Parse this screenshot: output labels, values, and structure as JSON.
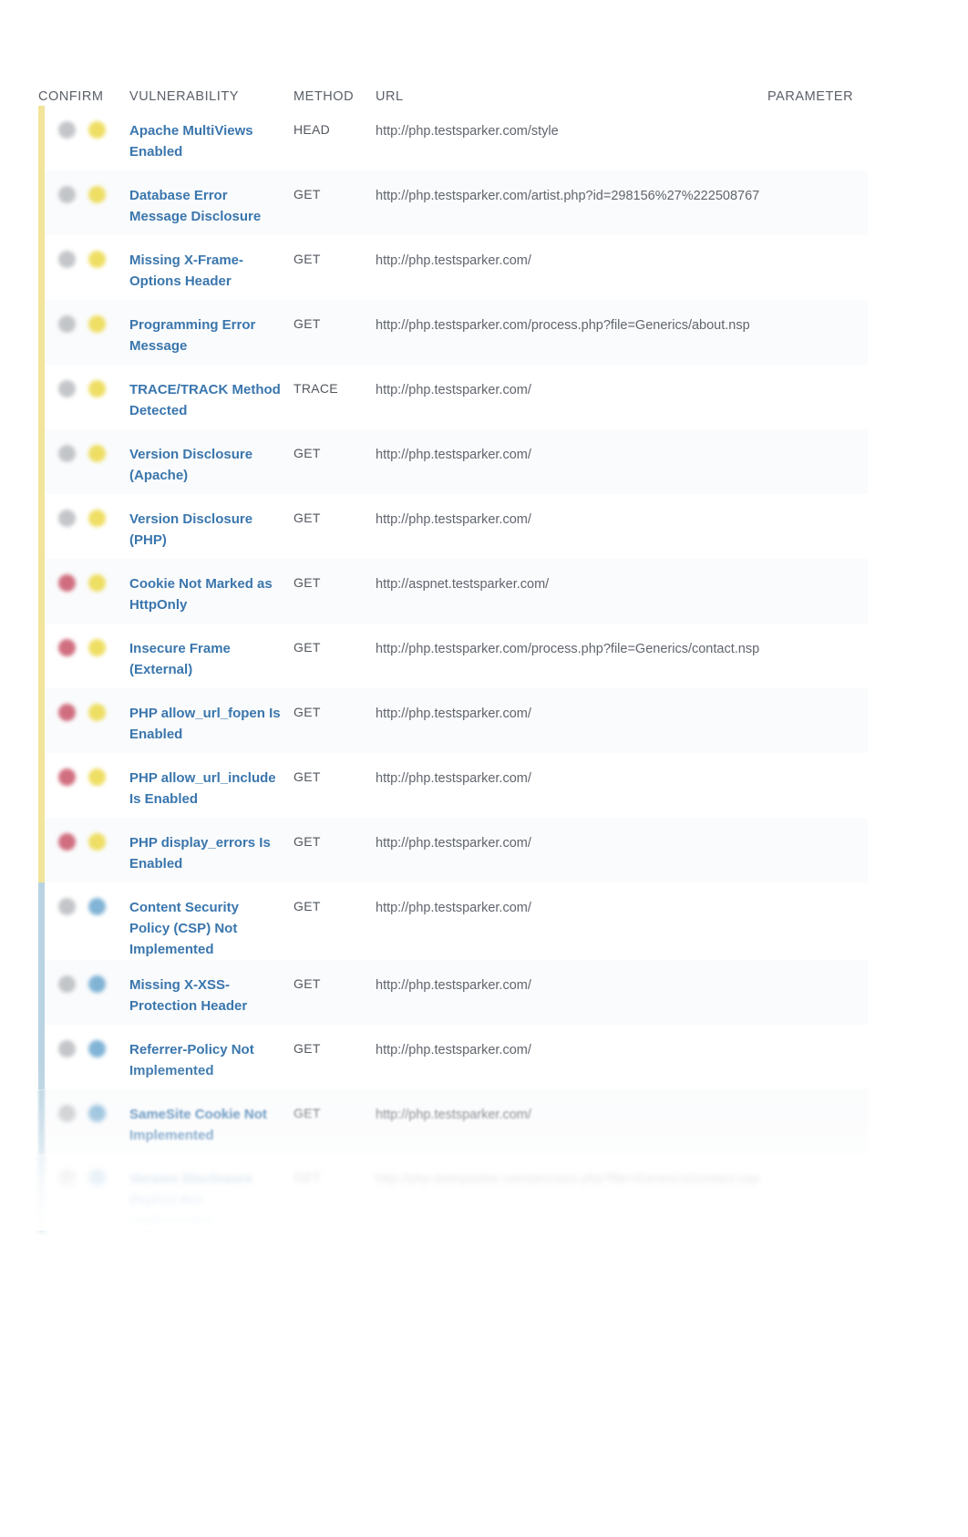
{
  "table": {
    "columns": [
      {
        "key": "confirm",
        "label": "CONFIRM"
      },
      {
        "key": "vulnerability",
        "label": "VULNERABILITY"
      },
      {
        "key": "method",
        "label": "METHOD"
      },
      {
        "key": "url",
        "label": "URL"
      },
      {
        "key": "parameter",
        "label": "PARAMETER"
      }
    ],
    "colors": {
      "severity_low": "#ecd949",
      "severity_information": "#6ca7cf",
      "confirmed_marker": "#c9566a",
      "unconfirmed_marker": "#b9bcc0",
      "link": "#3a76ad",
      "stripe_low": "#f2e49a",
      "stripe_information": "#b9d3e2"
    },
    "rows": [
      {
        "confirm_icon": "unconfirmed-marker-icon",
        "severity_icon": "severity-low-icon",
        "severity": "low",
        "vulnerability": "Apache MultiViews Enabled",
        "method": "HEAD",
        "url": "http://php.testsparker.com/style",
        "parameter": ""
      },
      {
        "confirm_icon": "unconfirmed-marker-icon",
        "severity_icon": "severity-low-icon",
        "severity": "low",
        "vulnerability": "Database Error Message Disclosure",
        "method": "GET",
        "url": "http://php.testsparker.com/artist.php?id=298156%27%222508767",
        "parameter": ""
      },
      {
        "confirm_icon": "unconfirmed-marker-icon",
        "severity_icon": "severity-low-icon",
        "severity": "low",
        "vulnerability": "Missing X-Frame-Options Header",
        "method": "GET",
        "url": "http://php.testsparker.com/",
        "parameter": ""
      },
      {
        "confirm_icon": "unconfirmed-marker-icon",
        "severity_icon": "severity-low-icon",
        "severity": "low",
        "vulnerability": "Programming Error Message",
        "method": "GET",
        "url": "http://php.testsparker.com/process.php?file=Generics/about.nsp",
        "parameter": ""
      },
      {
        "confirm_icon": "unconfirmed-marker-icon",
        "severity_icon": "severity-low-icon",
        "severity": "low",
        "vulnerability": "TRACE/TRACK Method Detected",
        "method": "TRACE",
        "url": "http://php.testsparker.com/",
        "parameter": ""
      },
      {
        "confirm_icon": "unconfirmed-marker-icon",
        "severity_icon": "severity-low-icon",
        "severity": "low",
        "vulnerability": "Version Disclosure (Apache)",
        "method": "GET",
        "url": "http://php.testsparker.com/",
        "parameter": ""
      },
      {
        "confirm_icon": "unconfirmed-marker-icon",
        "severity_icon": "severity-low-icon",
        "severity": "low",
        "vulnerability": "Version Disclosure (PHP)",
        "method": "GET",
        "url": "http://php.testsparker.com/",
        "parameter": ""
      },
      {
        "confirm_icon": "confirmed-marker-icon",
        "severity_icon": "severity-low-icon",
        "severity": "low",
        "vulnerability": "Cookie Not Marked as HttpOnly",
        "method": "GET",
        "url": "http://aspnet.testsparker.com/",
        "parameter": ""
      },
      {
        "confirm_icon": "confirmed-marker-icon",
        "severity_icon": "severity-low-icon",
        "severity": "low",
        "vulnerability": "Insecure Frame (External)",
        "method": "GET",
        "url": "http://php.testsparker.com/process.php?file=Generics/contact.nsp",
        "parameter": ""
      },
      {
        "confirm_icon": "confirmed-marker-icon",
        "severity_icon": "severity-low-icon",
        "severity": "low",
        "vulnerability": "PHP allow_url_fopen Is Enabled",
        "method": "GET",
        "url": "http://php.testsparker.com/",
        "parameter": ""
      },
      {
        "confirm_icon": "confirmed-marker-icon",
        "severity_icon": "severity-low-icon",
        "severity": "low",
        "vulnerability": "PHP allow_url_include Is Enabled",
        "method": "GET",
        "url": "http://php.testsparker.com/",
        "parameter": ""
      },
      {
        "confirm_icon": "confirmed-marker-icon",
        "severity_icon": "severity-low-icon",
        "severity": "low",
        "vulnerability": "PHP display_errors Is Enabled",
        "method": "GET",
        "url": "http://php.testsparker.com/",
        "parameter": ""
      },
      {
        "confirm_icon": "unconfirmed-marker-icon",
        "severity_icon": "severity-information-icon",
        "severity": "information",
        "vulnerability": "Content Security Policy (CSP) Not Implemented",
        "method": "GET",
        "url": "http://php.testsparker.com/",
        "parameter": ""
      },
      {
        "confirm_icon": "unconfirmed-marker-icon",
        "severity_icon": "severity-information-icon",
        "severity": "information",
        "vulnerability": "Missing X-XSS-Protection Header",
        "method": "GET",
        "url": "http://php.testsparker.com/",
        "parameter": ""
      },
      {
        "confirm_icon": "unconfirmed-marker-icon",
        "severity_icon": "severity-information-icon",
        "severity": "information",
        "vulnerability": "Referrer-Policy Not Implemented",
        "method": "GET",
        "url": "http://php.testsparker.com/",
        "parameter": ""
      },
      {
        "confirm_icon": "unconfirmed-marker-icon",
        "severity_icon": "severity-information-icon",
        "severity": "information",
        "vulnerability": "SameSite Cookie Not Implemented",
        "method": "GET",
        "url": "http://php.testsparker.com/",
        "parameter": ""
      },
      {
        "confirm_icon": "unconfirmed-marker-icon",
        "severity_icon": "severity-information-icon",
        "severity": "information",
        "vulnerability": "Version Disclosure (Nginx) Not Implemented",
        "method": "GET",
        "url": "http://php.testsparker.com/process.php?file=Generics/contact.nsp",
        "parameter": ""
      }
    ]
  }
}
